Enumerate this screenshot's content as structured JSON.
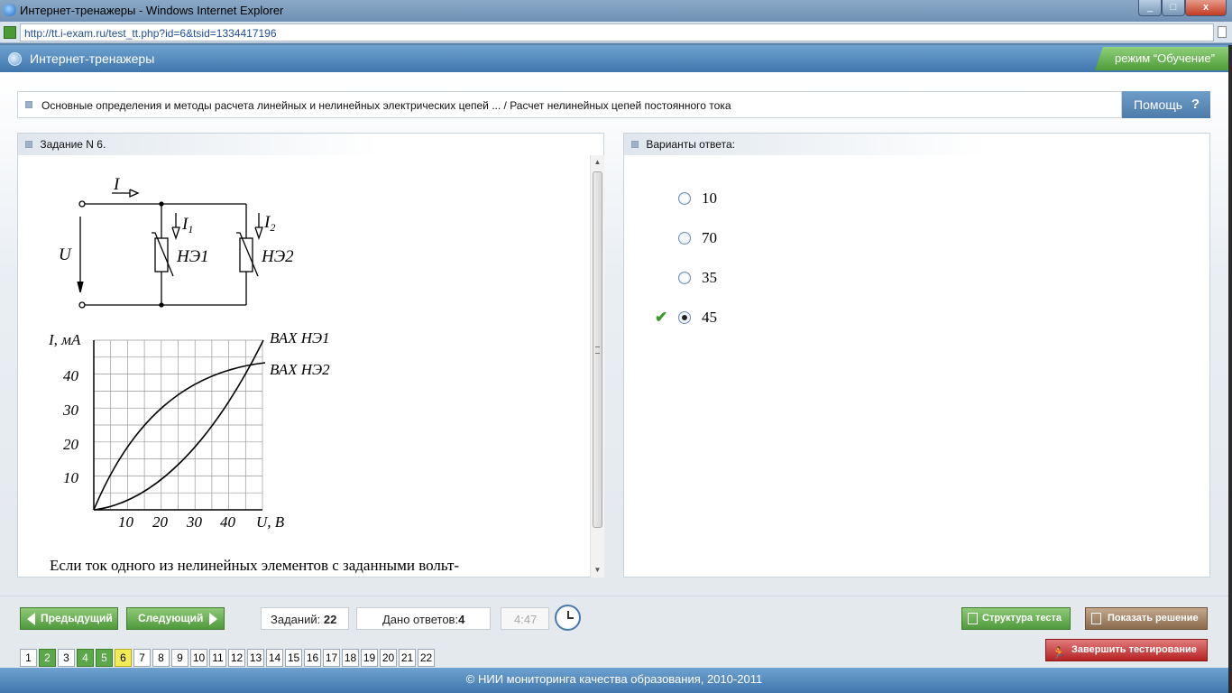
{
  "window": {
    "title": "Интернет-тренажеры - Windows Internet Explorer"
  },
  "address": {
    "url": "http://tt.i-exam.ru/test_tt.php?id=6&tsid=1334417196"
  },
  "header": {
    "app_title": "Интернет-тренажеры",
    "mode": "режим “Обучение”"
  },
  "breadcrumb": {
    "text": "Основные определения и методы расчета линейных и нелинейных электрических цепей ... / Расчет нелинейных цепей постоянного тока"
  },
  "help": {
    "label": "Помощь",
    "icon": "?"
  },
  "task": {
    "header": "Задание N 6.",
    "figure": {
      "current_total": "I",
      "current_1": "I",
      "current_1_sub": "1",
      "current_2": "I",
      "current_2_sub": "2",
      "voltage": "U",
      "element_1": "НЭ1",
      "element_2": "НЭ2",
      "y_axis_label": "I, мА",
      "x_axis_label": "U, В",
      "curve_1_label": "ВАХ НЭ1",
      "curve_2_label": "ВАХ НЭ2",
      "y_ticks": [
        "10",
        "20",
        "30",
        "40"
      ],
      "x_ticks": [
        "10",
        "20",
        "30",
        "40"
      ]
    },
    "question_text": "Если ток одного из нелинейных элементов с заданными вольт-"
  },
  "answers": {
    "header": "Варианты ответа:",
    "options": [
      {
        "value": "10",
        "selected": false,
        "correct": false
      },
      {
        "value": "70",
        "selected": false,
        "correct": false
      },
      {
        "value": "35",
        "selected": false,
        "correct": false
      },
      {
        "value": "45",
        "selected": true,
        "correct": true
      }
    ]
  },
  "nav": {
    "prev_label": "Предыдущий",
    "next_label": "Следующий",
    "tasks_label": "Заданий:",
    "tasks_count": "22",
    "answered_label": "Дано ответов:",
    "answered_count": "4",
    "timer": "4:47",
    "structure_label": "Структура теста",
    "solution_label": "Показать решение",
    "finish_label": "Завершить тестирование",
    "pages": [
      {
        "n": "1",
        "state": "normal"
      },
      {
        "n": "2",
        "state": "answered"
      },
      {
        "n": "3",
        "state": "normal"
      },
      {
        "n": "4",
        "state": "answered"
      },
      {
        "n": "5",
        "state": "answered"
      },
      {
        "n": "6",
        "state": "current"
      },
      {
        "n": "7",
        "state": "normal"
      },
      {
        "n": "8",
        "state": "normal"
      },
      {
        "n": "9",
        "state": "normal"
      },
      {
        "n": "10",
        "state": "normal"
      },
      {
        "n": "11",
        "state": "normal"
      },
      {
        "n": "12",
        "state": "normal"
      },
      {
        "n": "13",
        "state": "normal"
      },
      {
        "n": "14",
        "state": "normal"
      },
      {
        "n": "15",
        "state": "normal"
      },
      {
        "n": "16",
        "state": "normal"
      },
      {
        "n": "17",
        "state": "normal"
      },
      {
        "n": "18",
        "state": "normal"
      },
      {
        "n": "19",
        "state": "normal"
      },
      {
        "n": "20",
        "state": "normal"
      },
      {
        "n": "21",
        "state": "normal"
      },
      {
        "n": "22",
        "state": "normal"
      }
    ]
  },
  "footer": {
    "text": "© НИИ мониторинга качества образования, 2010-2011"
  },
  "colors": {
    "accent_blue": "#3f77ad",
    "accent_green": "#4f9a3c",
    "current_page": "#f4ec54",
    "finish_red": "#b52323"
  }
}
